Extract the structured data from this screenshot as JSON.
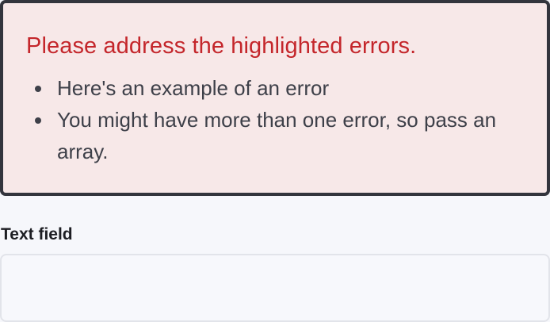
{
  "error_summary": {
    "title": "Please address the highlighted errors.",
    "errors": [
      "Here's an example of an error",
      "You might have more than one error, so pass an array."
    ],
    "colors": {
      "background": "#f7e8e8",
      "border": "#33353d",
      "title": "#c4262b"
    }
  },
  "text_field": {
    "label": "Text field",
    "value": "",
    "placeholder": ""
  }
}
